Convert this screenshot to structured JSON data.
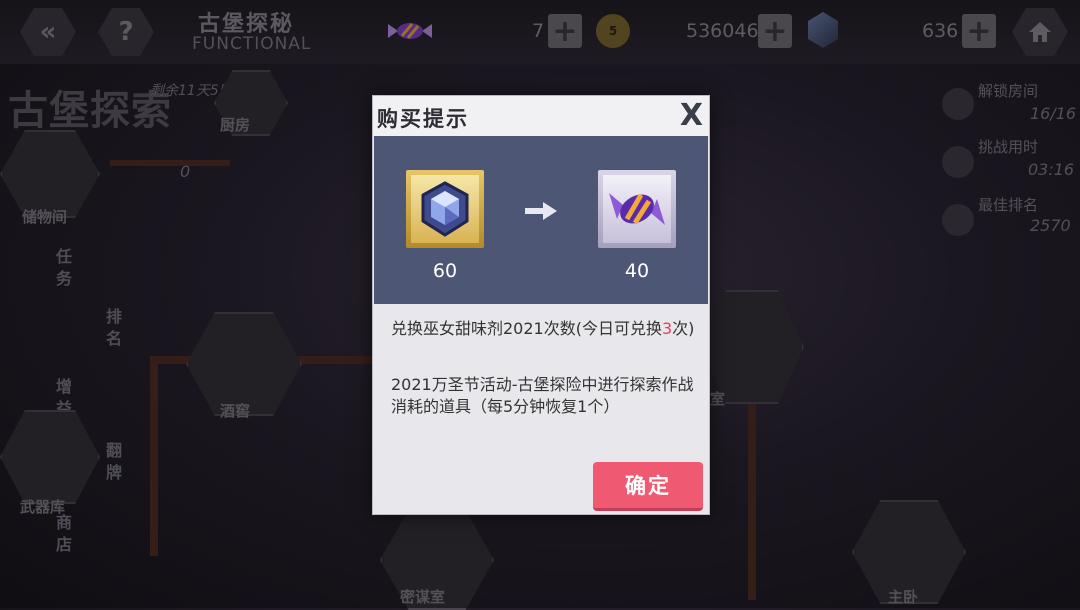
{
  "topbar": {
    "back_icon": "double-chevron-left-icon",
    "help_label": "?",
    "title": "古堡探秘",
    "subtitle": "FUNCTIONAL",
    "candy_count": "7",
    "coin_icon_label": "5",
    "coin_count": "536046",
    "gem_count": "636",
    "home_icon": "home-icon"
  },
  "background": {
    "event_title": "古堡探索",
    "remaining": "剩余11天5时",
    "room_kitchen": "厨房",
    "room_storage": "储物间",
    "candy_remaining": "0",
    "menu_tasks": "任务",
    "menu_rank": "排名",
    "menu_gain": "增益",
    "menu_cards": "翻牌",
    "room_cellar": "酒窖",
    "room_armory": "武器库",
    "menu_shop": "商店",
    "room_bottom": "密谋室",
    "room_partial": "室",
    "room_main": "主卧",
    "stats": {
      "unlocked_label": "解锁房间",
      "unlocked_value": "16/16",
      "time_label": "挑战用时",
      "time_value": "03:16",
      "rank_label": "最佳排名",
      "rank_value": "2570"
    }
  },
  "modal": {
    "title": "购买提示",
    "close_label": "X",
    "cost_qty": "60",
    "reward_qty": "40",
    "desc_prefix": "兑换巫女甜味剂2021次数(今日可兑换",
    "desc_count": "3",
    "desc_suffix": "次)",
    "description": "2021万圣节活动-古堡探险中进行探索作战消耗的道具（每5分钟恢复1个）",
    "confirm_label": "确定"
  },
  "colors": {
    "confirm": "#ef5a72",
    "panel": "#4e5675",
    "highlight": "#e2405c"
  }
}
